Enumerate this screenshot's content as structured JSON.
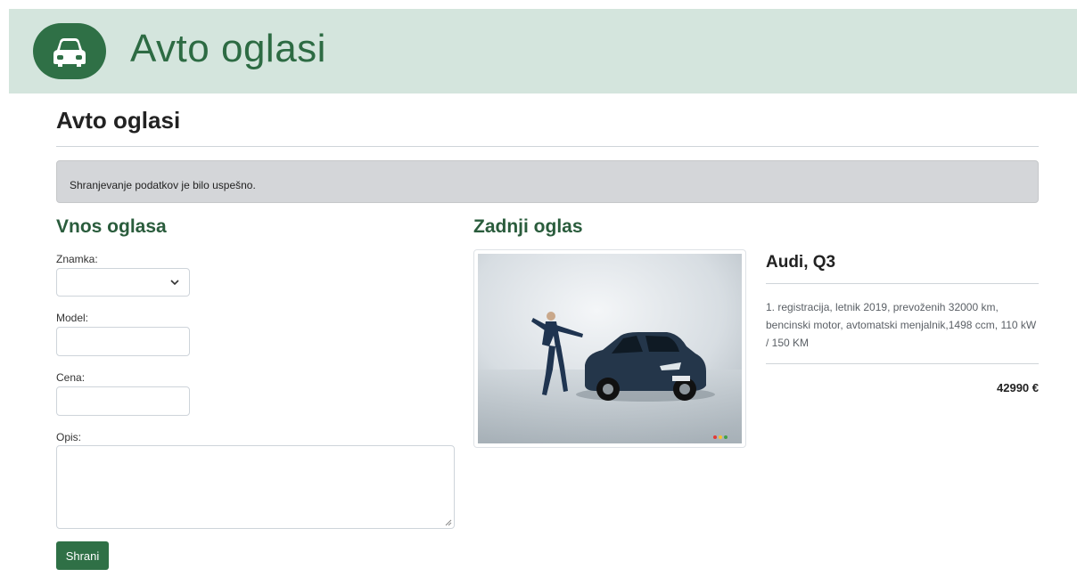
{
  "header": {
    "logo_icon": "car-front-icon",
    "brand_title": "Avto oglasi",
    "brand_color": "#2f7046",
    "banner_bg": "#d4e5dd"
  },
  "page": {
    "title": "Avto oglasi"
  },
  "alert": {
    "message": "Shranjevanje podatkov je bilo uspešno."
  },
  "form": {
    "title": "Vnos oglasa",
    "brand_label": "Znamka:",
    "brand_value": "",
    "model_label": "Model:",
    "model_value": "",
    "price_label": "Cena:",
    "price_value": "",
    "description_label": "Opis:",
    "description_value": "",
    "save_button": "Shrani"
  },
  "latest_ad": {
    "section_title": "Zadnji oglas",
    "image_icon": "car-photo",
    "car_title": "Audi, Q3",
    "description": "1. registracija, letnik 2019, prevoženih 32000 km, bencinski motor, avtomatski menjalnik,1498 ccm, 110 kW / 150 KM",
    "price": "42990 €"
  }
}
